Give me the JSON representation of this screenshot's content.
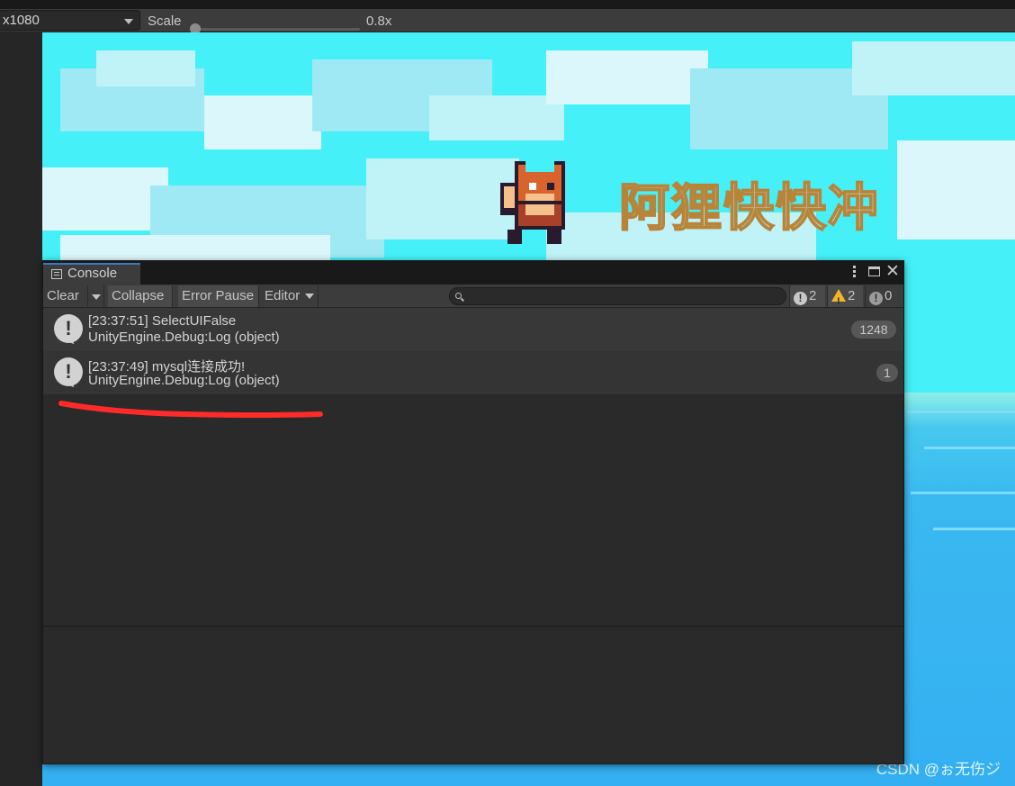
{
  "game_view_toolbar": {
    "resolution": "x1080",
    "scale_label": "Scale",
    "scale_value": "0.8x",
    "scale_level": 0.0
  },
  "game": {
    "title_text": "阿狸快快冲",
    "colors": {
      "sky": "#45f0f8",
      "sea": "#34b0f2",
      "title_stroke": "#b8843a"
    }
  },
  "console": {
    "tab_label": "Console",
    "toolbar": {
      "clear": "Clear",
      "collapse": "Collapse",
      "error_pause": "Error Pause",
      "editor": "Editor",
      "search_placeholder": "",
      "info_count": "2",
      "warning_count": "2",
      "error_count": "0"
    },
    "logs": [
      {
        "line1": "[23:37:51] SelectUIFalse",
        "line2": "UnityEngine.Debug:Log (object)",
        "count": "1248"
      },
      {
        "line1": "[23:37:49] mysql连接成功!",
        "line2": "UnityEngine.Debug:Log (object)",
        "count": "1"
      }
    ],
    "accent": "#3a79bb"
  },
  "watermark": "CSDN @ぉ无伤ジ"
}
